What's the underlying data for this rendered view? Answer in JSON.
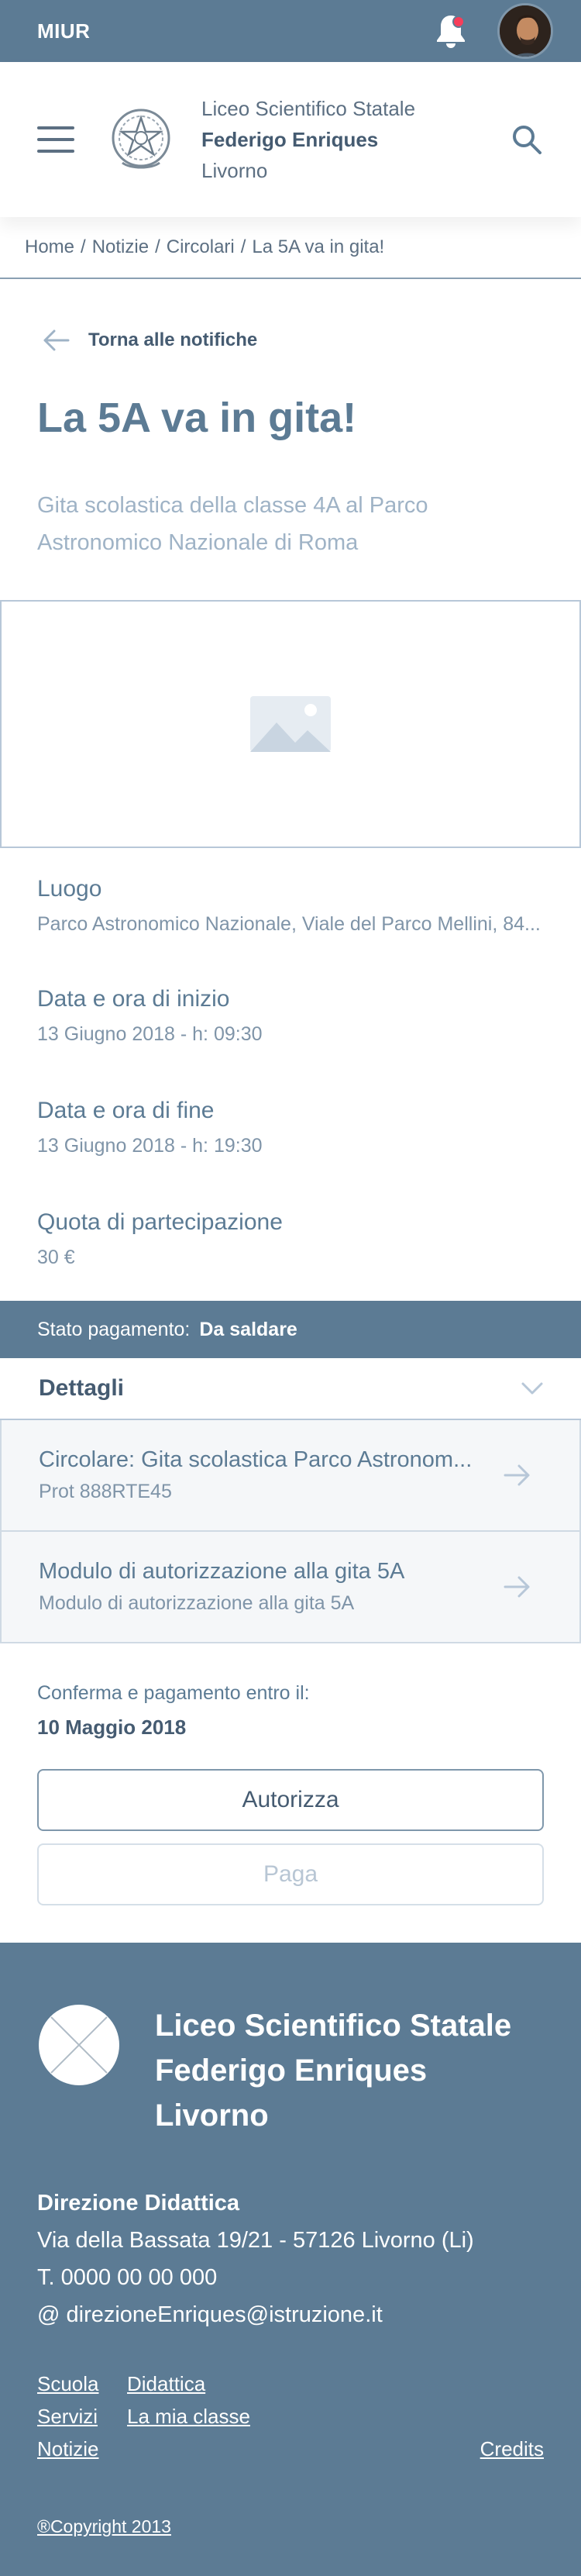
{
  "topbar": {
    "brand": "MIUR",
    "notification_icon": "bell-icon",
    "avatar_icon": "user-avatar"
  },
  "header": {
    "menu_icon": "hamburger-icon",
    "emblem_icon": "italian-republic-emblem",
    "school_line1": "Liceo Scientifico Statale",
    "school_line2": "Federigo Enriques",
    "school_line3": "Livorno",
    "search_icon": "search-icon"
  },
  "breadcrumb": [
    "Home",
    "Notizie",
    "Circolari",
    "La 5A va in gita!"
  ],
  "back_label": "Torna alle notifiche",
  "page_title": "La 5A va in gita!",
  "subtitle": "Gita scolastica della classe 4A al Parco Astronomico Nazionale di Roma",
  "image_placeholder_icon": "image-icon",
  "info": [
    {
      "label": "Luogo",
      "value": "Parco Astronomico Nazionale, Viale del Parco Mellini, 84..."
    },
    {
      "label": "Data e ora di inizio",
      "value": "13 Giugno 2018 - h: 09:30"
    },
    {
      "label": "Data e ora di fine",
      "value": "13 Giugno 2018 - h: 19:30"
    },
    {
      "label": "Quota di partecipazione",
      "value": "30 €"
    }
  ],
  "status": {
    "label": "Stato pagamento:",
    "value": "Da saldare"
  },
  "details": {
    "label": "Dettagli",
    "documents": [
      {
        "title": "Circolare: Gita scolastica Parco Astronom...",
        "subtitle": "Prot 888RTE45"
      },
      {
        "title": "Modulo di autorizzazione alla gita 5A",
        "subtitle": "Modulo di autorizzazione alla gita 5A"
      }
    ]
  },
  "deadline": {
    "label": "Conferma e pagamento entro il:",
    "date": "10 Maggio 2018"
  },
  "buttons": {
    "authorize": "Autorizza",
    "pay": "Paga"
  },
  "colors": {
    "primary": "#5c7b94",
    "notification_dot": "#f73e5a",
    "text": "#5c6f82"
  },
  "footer": {
    "name_line1": "Liceo Scientifico Statale",
    "name_line2": "Federigo Enriques",
    "name_line3": "Livorno",
    "contact_head": "Direzione Didattica",
    "address": "Via della Bassata 19/21 - 57126 Livorno (Li)",
    "phone": "T. 0000 00 00 000",
    "email": "@ direzioneEnriques@istruzione.it",
    "links": {
      "scuola": "Scuola",
      "didattica": "Didattica",
      "servizi": "Servizi",
      "classe": "La mia classe",
      "notizie": "Notizie",
      "credits": "Credits"
    },
    "copyright": "®Copyright 2013"
  }
}
